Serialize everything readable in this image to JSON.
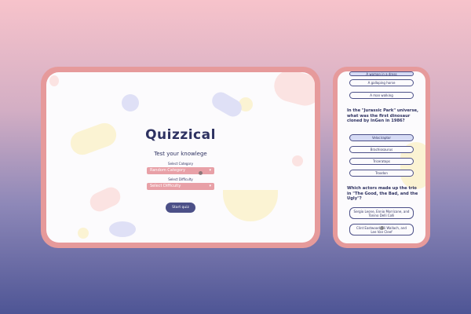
{
  "desktop": {
    "title": "Quizzical",
    "subtitle": "Test your knowlege",
    "category_label": "Select Category",
    "category_value": "Random Category",
    "difficulty_label": "Select Difficulty",
    "difficulty_value": "Select Difficulty",
    "start_button": "Start quiz"
  },
  "mobile": {
    "top_answers": [
      "A woman in a dress",
      "A galloping horse",
      "A man walking"
    ],
    "question_1": "In the \"Jurassic Park\" universe, what was the first dinosaur cloned by InGen in 1986?",
    "answers_1": [
      "Velociraptor",
      "Brachiosaurus",
      "Triceratops",
      "Troodon"
    ],
    "question_2": "Which actors made up the trio in \"The Good, the Bad, and the Ugly\"?",
    "answers_2": [
      "Sergio Leone, Ennio Morricone, and Tonino Delli Colli",
      "Clint Eastwood, Eli Wallach, and Lee Van Cleef"
    ]
  },
  "colors": {
    "accent": "#4c5088",
    "frame": "#e69a9b",
    "select_bg": "#e8a0a7",
    "selected_answer": "#d6dbf5"
  }
}
